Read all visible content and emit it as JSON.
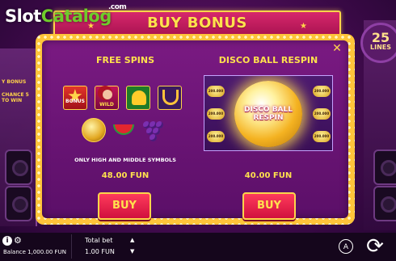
{
  "logo": {
    "slot": "Slot",
    "catalog": "Catalog",
    "com": ".com"
  },
  "header": {
    "title": "BUY BONUS"
  },
  "side": {
    "left_label": "Y BONUS",
    "left_sub": "CHANCE 5 TO WIN",
    "lines_number": "25",
    "lines_label": "LINES"
  },
  "free_spins": {
    "title": "FREE SPINS",
    "symbols": [
      "bonus-symbol",
      "wild-symbol",
      "bell-symbol",
      "horseshoe-symbol",
      "disco-symbol",
      "watermelon-symbol",
      "grapes-symbol"
    ],
    "bonus_label": "BONUS",
    "wild_label": "WILD",
    "note": "ONLY HIGH AND MIDDLE SYMBOLS",
    "price": "48.00 FUN",
    "buy_label": "BUY"
  },
  "disco_respin": {
    "title": "DISCO BALL RESPIN",
    "ball_label_1": "DISCO BALL",
    "ball_label_2": "RESPIN",
    "coin_value": "200.000",
    "price": "40.00 FUN",
    "buy_label": "BUY"
  },
  "close_label": "✕",
  "footer": {
    "info": "i",
    "balance": "Balance 1,000.00 FUN",
    "total_bet_label": "Total bet",
    "total_bet_value": "1.00 FUN",
    "auto_label": "A"
  }
}
